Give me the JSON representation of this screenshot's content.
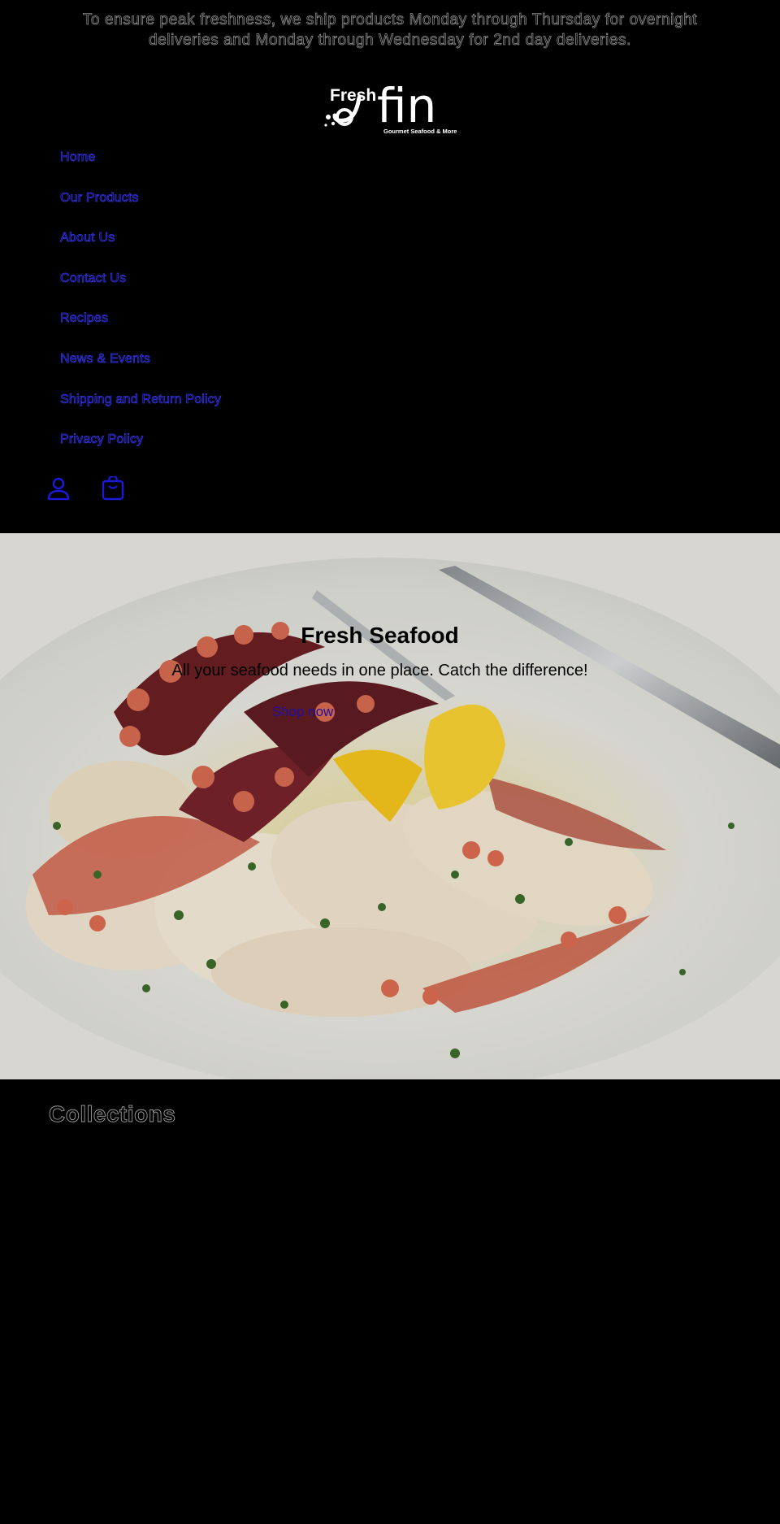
{
  "announcement": {
    "text": "To ensure peak freshness, we ship products Monday through Thursday for overnight deliveries and Monday through Wednesday for 2nd day deliveries."
  },
  "logo": {
    "word_small": "Fresh",
    "word_large": "fin",
    "tagline": "Gourmet Seafood & More"
  },
  "nav": {
    "items": [
      {
        "label": "Home"
      },
      {
        "label": "Our Products"
      },
      {
        "label": "About Us"
      },
      {
        "label": "Contact Us"
      },
      {
        "label": "Recipes"
      },
      {
        "label": "News & Events"
      },
      {
        "label": "Shipping and Return Policy"
      },
      {
        "label": "Privacy Policy"
      }
    ]
  },
  "header_icons": {
    "account": "account-icon",
    "cart": "cart-icon"
  },
  "hero": {
    "title": "Fresh Seafood",
    "subtitle": "All your seafood needs in one place. Catch the difference!",
    "button_label": "Shop now"
  },
  "collections": {
    "heading": "Collections"
  },
  "colors": {
    "background": "#000000",
    "link": "#3a3af0",
    "hero_button": "#2010a0"
  }
}
